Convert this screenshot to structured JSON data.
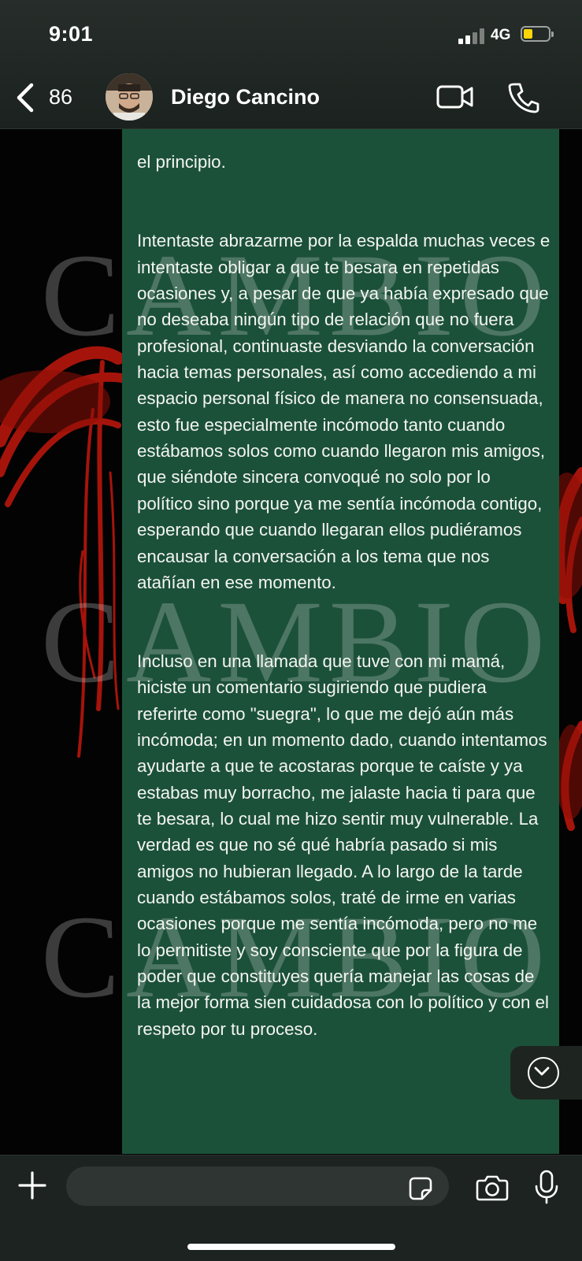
{
  "status_bar": {
    "time": "9:01",
    "network": "4G"
  },
  "header": {
    "back_count": "86",
    "contact_name": "Diego Cancino"
  },
  "message": {
    "paragraphs": [
      "el principio.",
      "Intentaste abrazarme por la espalda muchas veces e intentaste obligar a que te besara en repetidas ocasiones y, a pesar de que ya había expresado que no deseaba ningún tipo de relación que no fuera profesional, continuaste desviando la conversación hacia temas personales, así como accediendo a mi espacio personal físico de manera no consensuada, esto fue especialmente incómodo tanto cuando estábamos solos como cuando llegaron mis amigos, que siéndote sincera convoqué no solo por lo político sino porque ya me sentía incómoda contigo, esperando que cuando llegaran ellos pudiéramos encausar la conversación a los tema que nos atañían en ese momento.",
      "Incluso en una llamada que tuve con mi mamá, hiciste un comentario sugiriendo que pudiera referirte como \"suegra\", lo que me dejó aún más incómoda; en un momento dado, cuando intentamos ayudarte a que te acostaras porque te caíste y ya estabas muy borracho, me jalaste hacia ti para que te besara, lo cual me hizo sentir muy vulnerable. La verdad es que no sé qué habría pasado si mis amigos no hubieran llegado. A lo largo de la tarde cuando estábamos solos, traté de irme en varias ocasiones porque me sentía incómoda, pero no me lo permitiste y soy consciente que por la figura de poder que constituyes quería manejar las cosas de la mejor forma sien cuidadosa con lo político y con el respeto por tu proceso."
    ]
  },
  "watermark": {
    "text": "CAMBIO"
  },
  "icons": {
    "back": "chevron-left-icon",
    "video": "video-camera-icon",
    "call": "phone-icon",
    "scroll": "chevron-down-icon",
    "attach": "plus-icon",
    "sticker": "sticker-icon",
    "camera": "camera-icon",
    "mic": "microphone-icon"
  },
  "colors": {
    "bubble": "#1c5139",
    "header_bg": "#1f2622",
    "battery_fill": "#ffd60a"
  }
}
